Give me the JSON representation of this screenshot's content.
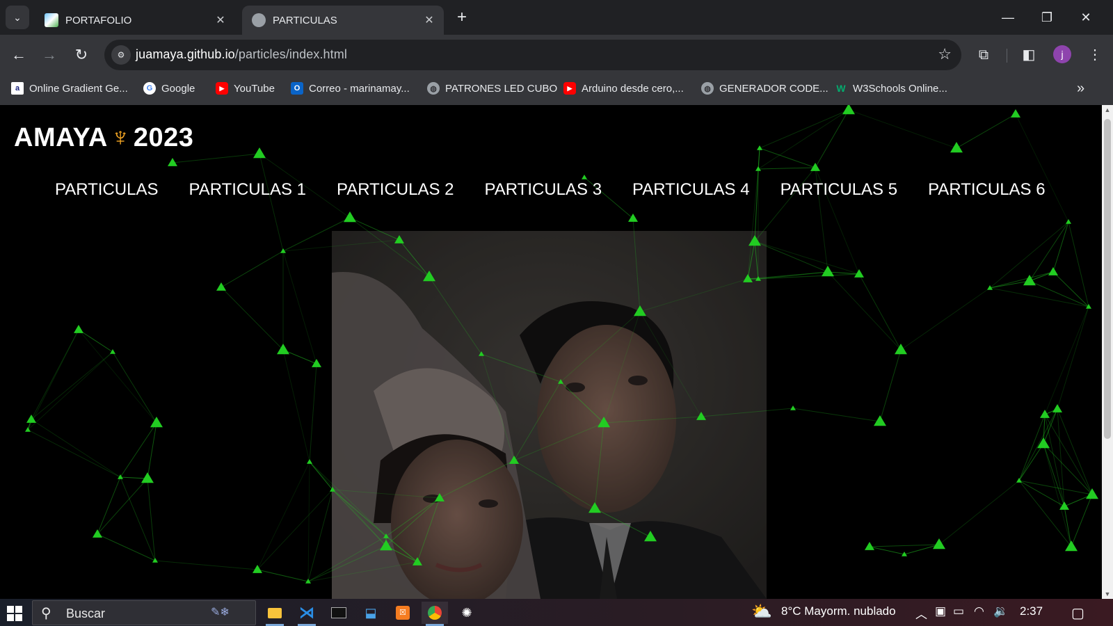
{
  "browser": {
    "tabs": [
      {
        "title": "PORTAFOLIO",
        "active": false
      },
      {
        "title": "PARTICULAS",
        "active": true
      }
    ],
    "url_host": "juamaya.github.io",
    "url_path": "/particles/index.html",
    "avatar_letter": "j",
    "bookmarks": [
      {
        "label": "Online Gradient Ge...",
        "icon": "a"
      },
      {
        "label": "Google",
        "icon": "G"
      },
      {
        "label": "YouTube",
        "icon": "▶"
      },
      {
        "label": "Correo - marinamay...",
        "icon": "O"
      },
      {
        "label": "PATRONES LED CUBO",
        "icon": "globe"
      },
      {
        "label": "Arduino desde cero,...",
        "icon": "▶"
      },
      {
        "label": "GENERADOR CODE...",
        "icon": "globe"
      },
      {
        "label": "W3Schools Online...",
        "icon": "W"
      }
    ]
  },
  "page": {
    "title_left": "AMAYA",
    "title_symbol": "♆",
    "title_right": "2023",
    "nav": [
      "PARTICULAS",
      "PARTICULAS 1",
      "PARTICULAS 2",
      "PARTICULAS 3",
      "PARTICULAS 4",
      "PARTICULAS 5",
      "PARTICULAS 6"
    ],
    "particle_color": "#22cc22"
  },
  "taskbar": {
    "search_placeholder": "Buscar",
    "weather": "8°C  Mayorm. nublado",
    "time": "2:37"
  }
}
